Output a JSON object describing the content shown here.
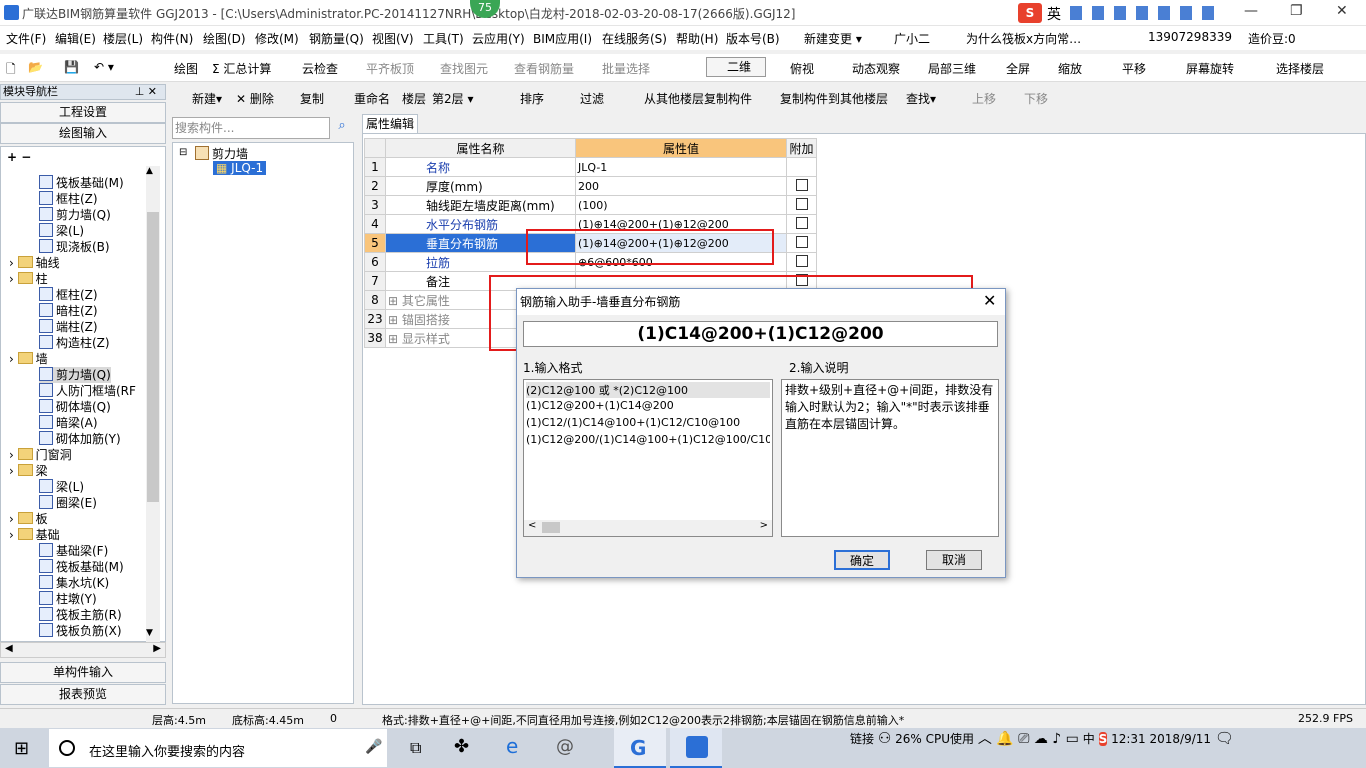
{
  "window": {
    "title": "广联达BIM钢筋算量软件 GGJ2013 - [C:\\Users\\Administrator.PC-20141127NRH\\Desktop\\白龙村-2018-02-03-20-08-17(2666版).GGJ12]",
    "badge": "75"
  },
  "menu": {
    "items": [
      "文件(F)",
      "编辑(E)",
      "楼层(L)",
      "构件(N)",
      "绘图(D)",
      "修改(M)",
      "钢筋量(Q)",
      "视图(V)",
      "工具(T)",
      "云应用(Y)",
      "BIM应用(I)",
      "在线服务(S)",
      "帮助(H)",
      "版本号(B)",
      "新建变更",
      "广小二"
    ],
    "ad_text": "为什么筏板x方向常…",
    "phone": "13907298339",
    "beans": "造价豆:0"
  },
  "toolbar1": {
    "items": [
      "绘图",
      "Σ 汇总计算",
      "云检查",
      "平齐板顶",
      "查找图元",
      "查看钢筋量",
      "批量选择",
      "二维",
      "俯视",
      "动态观察",
      "局部三维",
      "全屏",
      "缩放",
      "平移",
      "屏幕旋转",
      "选择楼层"
    ]
  },
  "nav": {
    "header": "模块导航栏",
    "btn_settings": "工程设置",
    "btn_draw": "绘图输入",
    "btn_single": "单构件输入",
    "btn_report": "报表预览",
    "tree": [
      {
        "label": "筏板基础(M)",
        "level": 2
      },
      {
        "label": "框柱(Z)",
        "level": 2
      },
      {
        "label": "剪力墙(Q)",
        "level": 2
      },
      {
        "label": "梁(L)",
        "level": 2
      },
      {
        "label": "现浇板(B)",
        "level": 2
      },
      {
        "label": "轴线",
        "level": 1
      },
      {
        "label": "柱",
        "level": 1
      },
      {
        "label": "框柱(Z)",
        "level": 2
      },
      {
        "label": "暗柱(Z)",
        "level": 2
      },
      {
        "label": "端柱(Z)",
        "level": 2
      },
      {
        "label": "构造柱(Z)",
        "level": 2
      },
      {
        "label": "墙",
        "level": 1
      },
      {
        "label": "剪力墙(Q)",
        "level": 2
      },
      {
        "label": "人防门框墙(RF",
        "level": 2
      },
      {
        "label": "砌体墙(Q)",
        "level": 2
      },
      {
        "label": "暗梁(A)",
        "level": 2
      },
      {
        "label": "砌体加筋(Y)",
        "level": 2
      },
      {
        "label": "门窗洞",
        "level": 1
      },
      {
        "label": "梁",
        "level": 1
      },
      {
        "label": "梁(L)",
        "level": 2
      },
      {
        "label": "圈梁(E)",
        "level": 2
      },
      {
        "label": "板",
        "level": 1
      },
      {
        "label": "基础",
        "level": 1
      },
      {
        "label": "基础梁(F)",
        "level": 2
      },
      {
        "label": "筏板基础(M)",
        "level": 2
      },
      {
        "label": "集水坑(K)",
        "level": 2
      },
      {
        "label": "柱墩(Y)",
        "level": 2
      },
      {
        "label": "筏板主筋(R)",
        "level": 2
      },
      {
        "label": "筏板负筋(X)",
        "level": 2
      }
    ]
  },
  "toolbar2": {
    "items": [
      "新建",
      "删除",
      "复制",
      "重命名",
      "楼层",
      "第2层",
      "排序",
      "过滤",
      "从其他楼层复制构件",
      "复制构件到其他楼层",
      "查找",
      "上移",
      "下移"
    ]
  },
  "component": {
    "search_placeholder": "搜索构件...",
    "root": "剪力墙",
    "child": "JLQ-1"
  },
  "props": {
    "tab": "属性编辑",
    "col_name": "属性名称",
    "col_value": "属性值",
    "col_extra": "附加",
    "rows": [
      {
        "num": "1",
        "name": "名称",
        "value": "JLQ-1",
        "blue": true,
        "chk": false
      },
      {
        "num": "2",
        "name": "厚度(mm)",
        "value": "200",
        "blue": false,
        "chk": true
      },
      {
        "num": "3",
        "name": "轴线距左墙皮距离(mm)",
        "value": "(100)",
        "blue": false,
        "chk": true
      },
      {
        "num": "4",
        "name": "水平分布钢筋",
        "value": "(1)⊕14@200+(1)⊕12@200",
        "blue": true,
        "chk": true
      },
      {
        "num": "5",
        "name": "垂直分布钢筋",
        "value": "(1)⊕14@200+(1)⊕12@200",
        "blue": true,
        "chk": true
      },
      {
        "num": "6",
        "name": "拉筋",
        "value": "⊕6@600*600",
        "blue": true,
        "chk": true
      },
      {
        "num": "7",
        "name": "备注",
        "value": "",
        "blue": false,
        "chk": true
      },
      {
        "num": "8",
        "name": "其它属性",
        "value": "",
        "blue": false,
        "chk": false
      },
      {
        "num": "23",
        "name": "锚固搭接",
        "value": "",
        "blue": false,
        "chk": false
      },
      {
        "num": "38",
        "name": "显示样式",
        "value": "",
        "blue": false,
        "chk": false
      }
    ]
  },
  "dialog": {
    "title": "钢筋输入助手-墙垂直分布钢筋",
    "value": "(1)C14@200+(1)C12@200",
    "format_label": "1.输入格式",
    "desc_label": "2.输入说明",
    "formats": [
      "(2)C12@100 或 *(2)C12@100",
      "(1)C12@200+(1)C14@200",
      "(1)C12/(1)C14@100+(1)C12/C10@100",
      "(1)C12@200/(1)C14@100+(1)C12@100/C10@200"
    ],
    "description": "排数+级别+直径+@+间距，排数没有输入时默认为2；输入\"*\"时表示该排垂直筋在本层锚固计算。",
    "ok": "确定",
    "cancel": "取消"
  },
  "status": {
    "floor_height": "层高:4.5m",
    "base_height": "底标高:4.45m",
    "zero": "0",
    "hint": "格式:排数+直径+@+间距,不同直径用加号连接,例如2C12@200表示2排钢筋;本层锚固在钢筋信息前输入*",
    "fps": "252.9 FPS"
  },
  "taskbar": {
    "search": "在这里输入你要搜索的内容",
    "link": "链接",
    "cpu_pct": "26%",
    "cpu_label": "CPU使用",
    "ime": "中",
    "time": "12:31",
    "date": "2018/9/11",
    "ime_top": "英"
  }
}
